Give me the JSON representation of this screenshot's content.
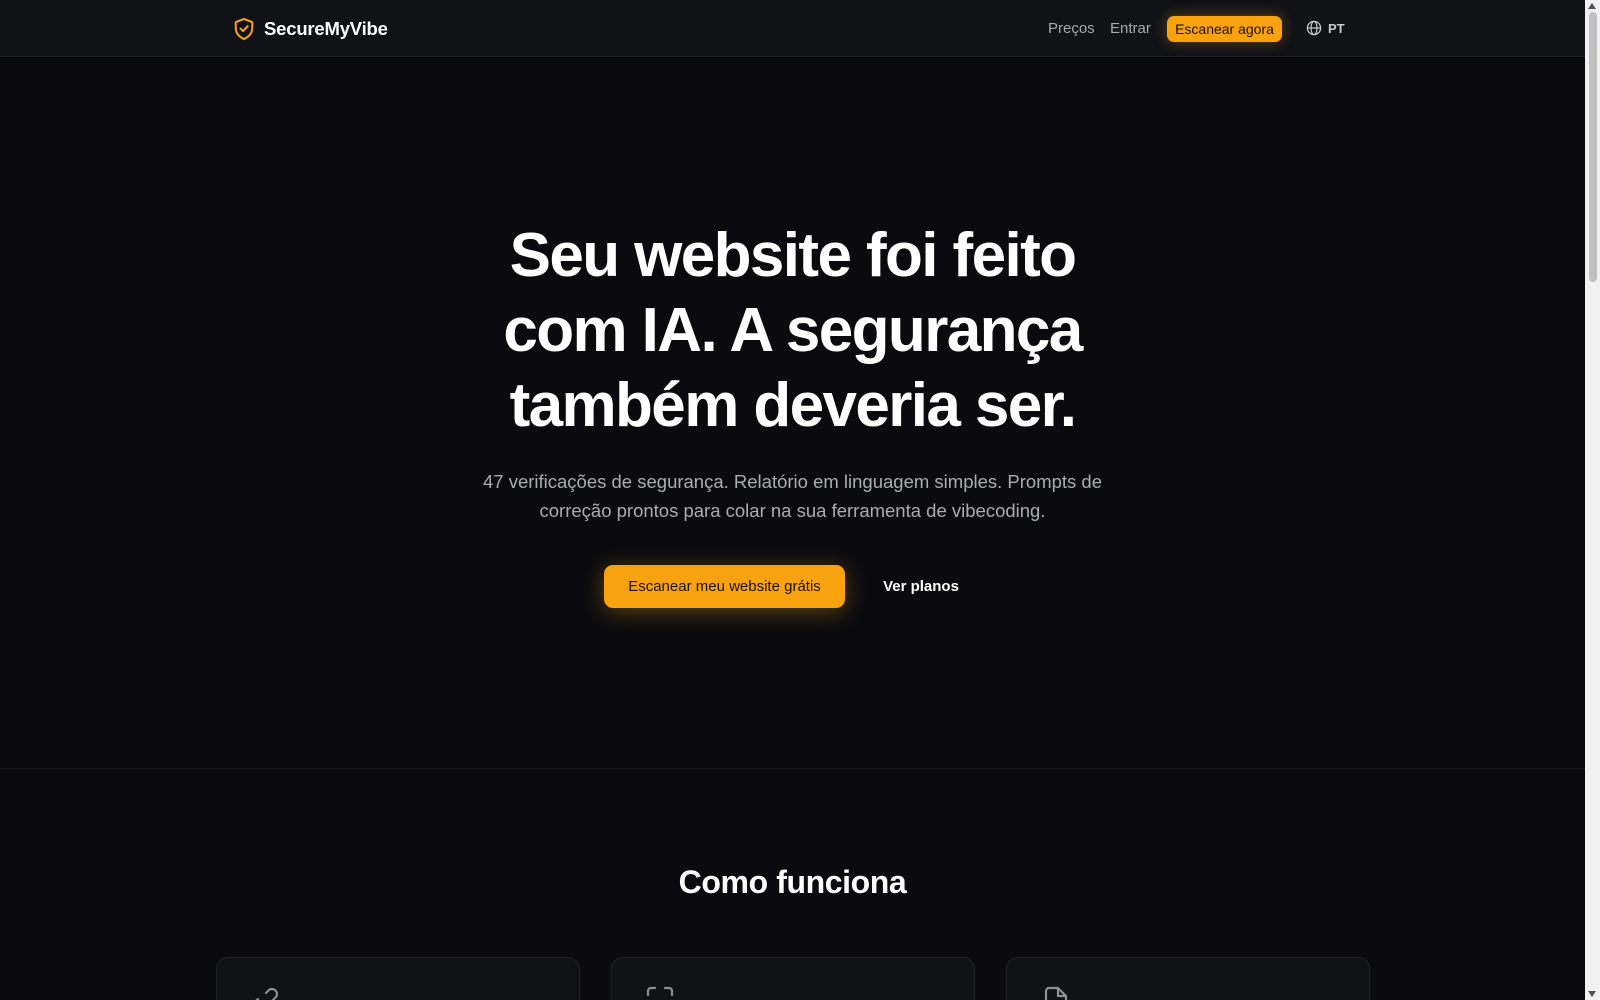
{
  "brand": {
    "name": "SecureMyVibe",
    "icon": "shield-check-icon",
    "accent": "#f7a20e"
  },
  "nav": {
    "pricing_label": "Preços",
    "login_label": "Entrar",
    "cta_label": "Escanear agora",
    "language_label": "PT",
    "language_icon": "globe-icon"
  },
  "hero": {
    "title_line_1": "Seu website foi feito",
    "title_line_2": "com IA. A segurança",
    "title_line_3": "também deveria ser.",
    "subtitle_line_1": "47 verificações de segurança. Relatório em linguagem simples. Prompts de",
    "subtitle_line_2": "correção prontos para colar na sua ferramenta de vibecoding.",
    "primary_button": "Escanear meu website grátis",
    "secondary_button": "Ver planos"
  },
  "how_it_works": {
    "title": "Como funciona",
    "cards": [
      {
        "icon": "link-icon"
      },
      {
        "icon": "scan-icon"
      },
      {
        "icon": "document-icon"
      }
    ]
  },
  "colors": {
    "background": "#0b0b0f",
    "topbar": "#111217",
    "card": "#111217",
    "muted_text": "#a9abb6"
  }
}
